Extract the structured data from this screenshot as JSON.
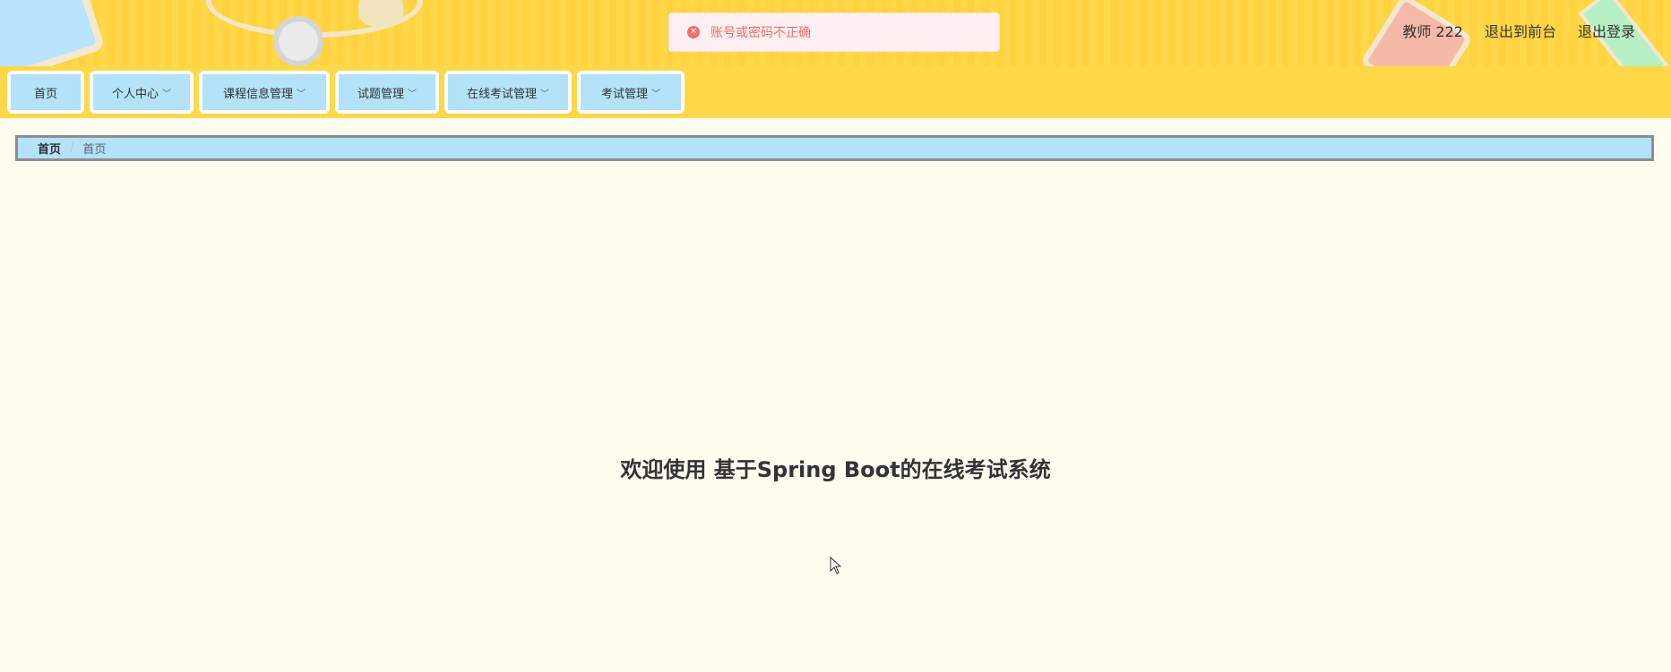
{
  "toast": {
    "icon": "error-circle-icon",
    "message": "账号或密码不正确",
    "color": "#f56c6c"
  },
  "header": {
    "user_label": "教师 222",
    "front_link": "退出到前台",
    "logout_link": "退出登录"
  },
  "nav": {
    "items": [
      {
        "label": "首页",
        "has_dropdown": false
      },
      {
        "label": "个人中心",
        "has_dropdown": true
      },
      {
        "label": "课程信息管理",
        "has_dropdown": true
      },
      {
        "label": "试题管理",
        "has_dropdown": true
      },
      {
        "label": "在线考试管理",
        "has_dropdown": true
      },
      {
        "label": "考试管理",
        "has_dropdown": true
      }
    ],
    "dropdown_icon": "chevron-down-icon"
  },
  "breadcrumb": {
    "items": [
      "首页",
      "首页"
    ],
    "separator": "/"
  },
  "main": {
    "welcome": "欢迎使用 基于Spring Boot的在线考试系统"
  },
  "colors": {
    "header_bg": "#ffd84a",
    "nav_item_bg": "#b3e2f9",
    "page_bg": "#fffcf0"
  }
}
